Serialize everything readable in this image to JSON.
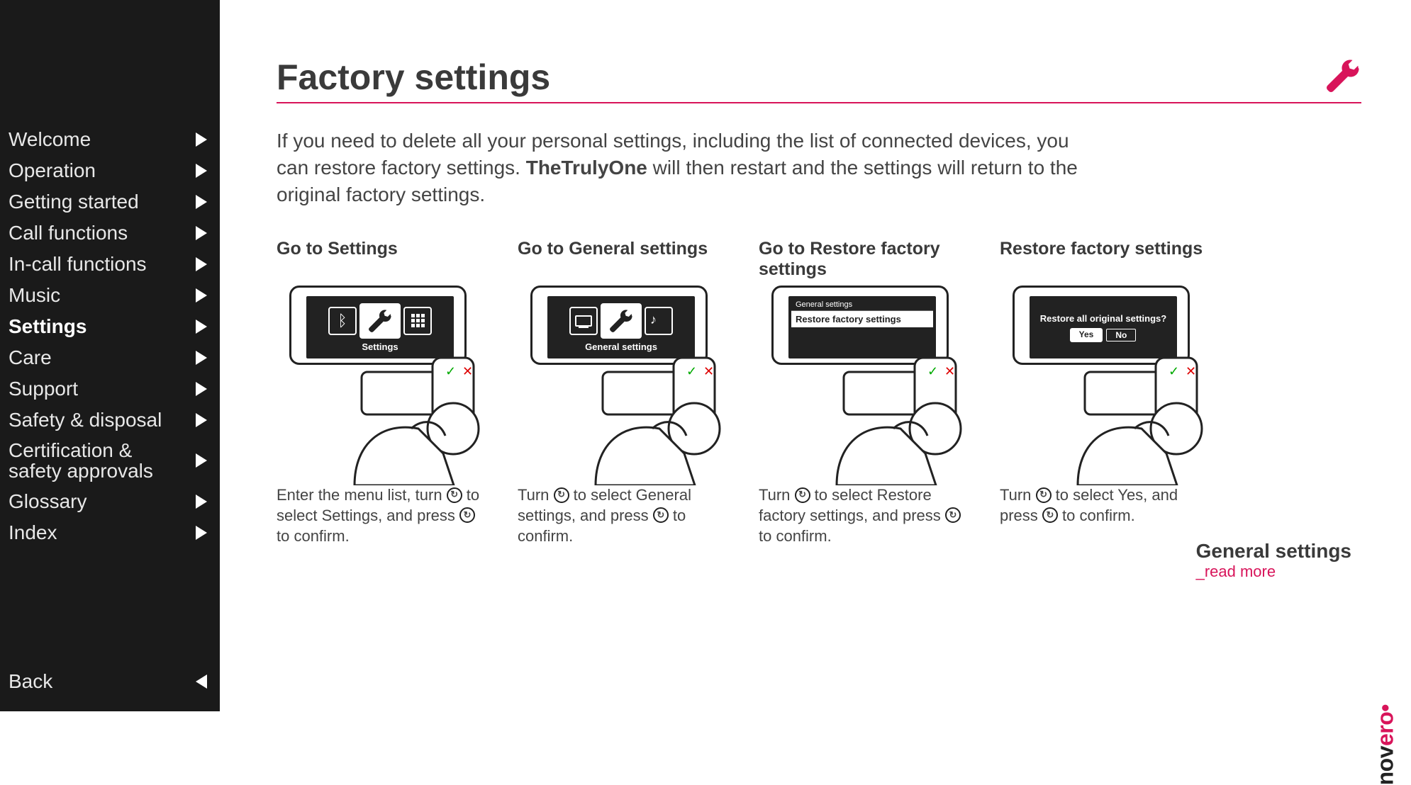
{
  "sidebar": {
    "items": [
      {
        "label": "Welcome"
      },
      {
        "label": "Operation"
      },
      {
        "label": "Getting started"
      },
      {
        "label": "Call functions"
      },
      {
        "label": "In-call functions"
      },
      {
        "label": "Music"
      },
      {
        "label": "Settings"
      },
      {
        "label": "Care"
      },
      {
        "label": "Support"
      },
      {
        "label": "Safety & disposal"
      },
      {
        "label": "Certification & safety approvals"
      },
      {
        "label": "Glossary"
      },
      {
        "label": "Index"
      }
    ],
    "back": "Back"
  },
  "page": {
    "title": "Factory settings",
    "intro_a": "If you need to delete all your personal settings, including the list of connected devices, you can restore factory settings. ",
    "intro_b": "TheTrulyOne",
    "intro_c": " will then restart and the settings will return to the original factory settings."
  },
  "steps": [
    {
      "title": "Go to Settings",
      "screen_label": "Settings",
      "desc_a": "Enter the menu list, turn ",
      "desc_b": " to select Settings, and press ",
      "desc_c": " to confirm."
    },
    {
      "title": "Go to General settings",
      "screen_label": "General settings",
      "desc_a": "Turn ",
      "desc_b": " to select General settings, and press ",
      "desc_c": " to confirm."
    },
    {
      "title": "Go to Restore factory settings",
      "menu_head": "General settings",
      "menu_item": "Restore factory settings",
      "desc_a": "Turn ",
      "desc_b": " to select Restore factory settings, and press ",
      "desc_c": " to confirm."
    },
    {
      "title": "Restore factory settings",
      "confirm_q": "Restore all original settings?",
      "yes": "Yes",
      "no": "No",
      "desc_a": "Turn ",
      "desc_b": " to select Yes, and press ",
      "desc_c": " to confirm."
    }
  ],
  "related": {
    "title": "General settings",
    "more": "_read more"
  },
  "brand": {
    "a": "nov",
    "b": "ero"
  }
}
